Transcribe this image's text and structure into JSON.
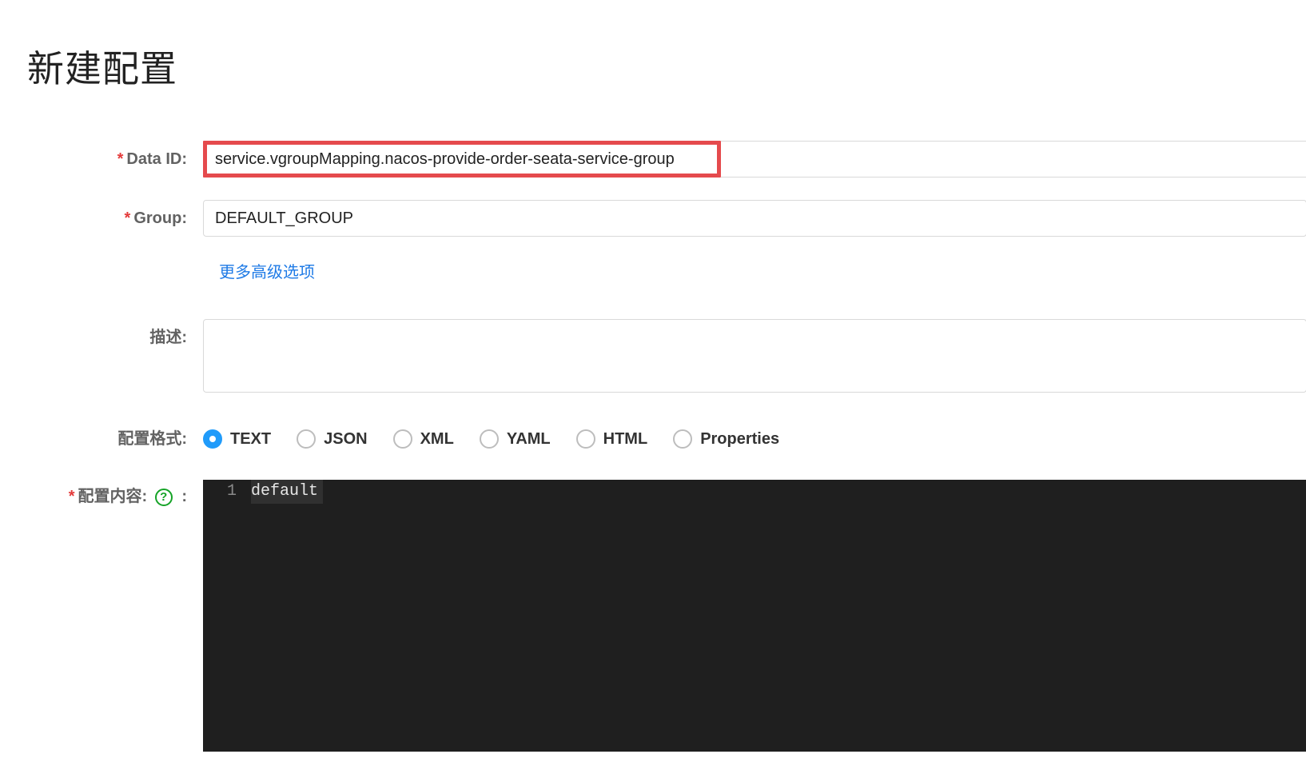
{
  "page": {
    "title": "新建配置"
  },
  "form": {
    "dataId": {
      "label": "Data ID:",
      "value": "service.vgroupMapping.nacos-provide-order-seata-service-group",
      "required": true
    },
    "group": {
      "label": "Group:",
      "value": "DEFAULT_GROUP",
      "required": true
    },
    "advanced_link": "更多高级选项",
    "description": {
      "label": "描述:",
      "value": "",
      "required": false
    },
    "format": {
      "label": "配置格式:",
      "selected": "TEXT",
      "options": [
        "TEXT",
        "JSON",
        "XML",
        "YAML",
        "HTML",
        "Properties"
      ]
    },
    "content": {
      "label": "配置内容:",
      "colon_after_help": ":",
      "required": true,
      "lines": [
        {
          "n": "1",
          "text": "default"
        }
      ]
    }
  }
}
